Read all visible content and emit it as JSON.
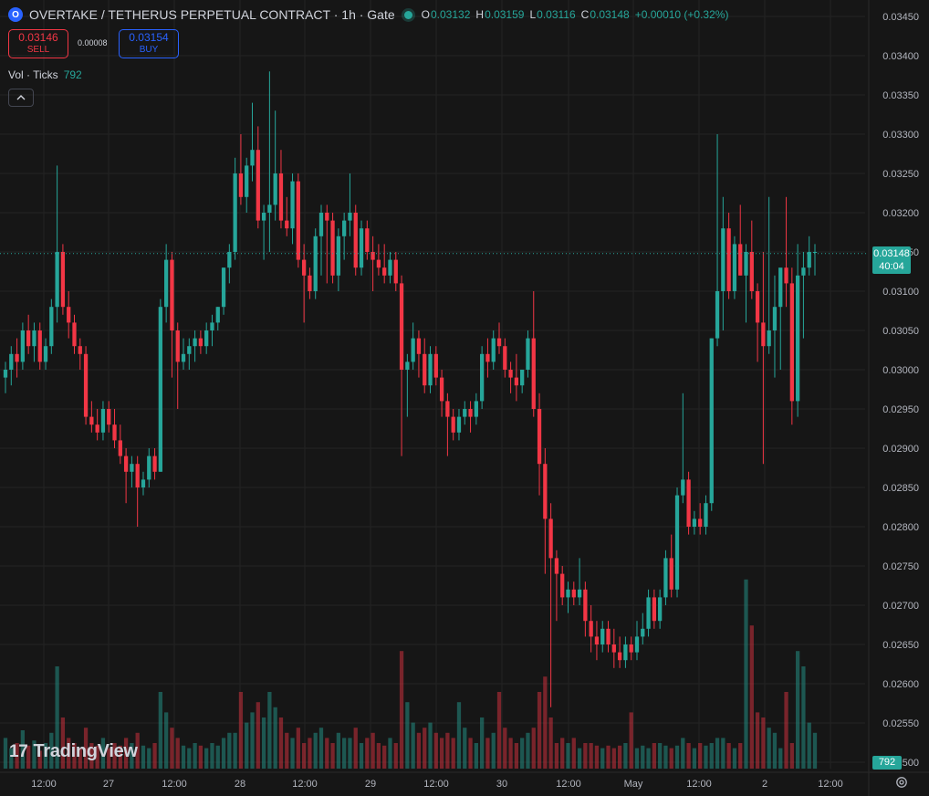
{
  "header": {
    "symbol_icon": "O",
    "title": "OVERTAKE / TETHERUS PERPETUAL CONTRACT · 1h · Gate",
    "o_label": "O",
    "o_value": "0.03132",
    "h_label": "H",
    "h_value": "0.03159",
    "l_label": "L",
    "l_value": "0.03116",
    "c_label": "C",
    "c_value": "0.03148",
    "change": "+0.00010 (+0.32%)"
  },
  "trade": {
    "sell_price": "0.03146",
    "sell_label": "SELL",
    "spread": "0.00008",
    "buy_price": "0.03154",
    "buy_label": "BUY"
  },
  "volume_legend": {
    "label": "Vol · Ticks",
    "value": "792"
  },
  "collapse_icon": "chevron-up-icon",
  "logo": {
    "mark": "17",
    "text": "TradingView"
  },
  "last_price_label": {
    "price": "0.03148",
    "countdown": "40:04"
  },
  "volume_label": "792",
  "settings_icon": "gear-icon",
  "colors": {
    "up": "#26a69a",
    "down": "#f23645",
    "background": "#161616",
    "grid": "#242424"
  },
  "chart_data": {
    "type": "candlestick",
    "title": "OVERTAKE / TETHERUS PERPETUAL CONTRACT · 1h · Gate",
    "ylim": [
      0.02485,
      0.03465
    ],
    "y_ticks": [
      "0.03450",
      "0.03400",
      "0.03350",
      "0.03300",
      "0.03250",
      "0.03200",
      "0.03150",
      "0.03100",
      "0.03050",
      "0.03000",
      "0.02950",
      "0.02900",
      "0.02850",
      "0.02800",
      "0.02750",
      "0.02700",
      "0.02650",
      "0.02600",
      "0.02550",
      "0.02500"
    ],
    "x_ticks": [
      "12:00",
      "27",
      "12:00",
      "28",
      "12:00",
      "29",
      "12:00",
      "30",
      "12:00",
      "May",
      "12:00",
      "2",
      "12:00"
    ],
    "last_price": 0.03148,
    "series": [
      {
        "name": "Price",
        "values": [
          [
            0.0299,
            0.0301,
            0.0297,
            0.03
          ],
          [
            0.03,
            0.0303,
            0.0298,
            0.0302
          ],
          [
            0.0302,
            0.0304,
            0.0299,
            0.0301
          ],
          [
            0.0301,
            0.0306,
            0.03,
            0.0305
          ],
          [
            0.0305,
            0.0307,
            0.0302,
            0.0303
          ],
          [
            0.0303,
            0.0306,
            0.0301,
            0.0305
          ],
          [
            0.0305,
            0.0306,
            0.03,
            0.0301
          ],
          [
            0.0301,
            0.0304,
            0.03,
            0.0303
          ],
          [
            0.0303,
            0.0309,
            0.0302,
            0.0308
          ],
          [
            0.0308,
            0.0326,
            0.0306,
            0.0315
          ],
          [
            0.0315,
            0.0316,
            0.0307,
            0.0308
          ],
          [
            0.0308,
            0.031,
            0.0304,
            0.0306
          ],
          [
            0.0306,
            0.0307,
            0.0302,
            0.0303
          ],
          [
            0.0303,
            0.0304,
            0.03,
            0.0302
          ],
          [
            0.0302,
            0.0303,
            0.0293,
            0.0294
          ],
          [
            0.0294,
            0.0296,
            0.0292,
            0.0293
          ],
          [
            0.0293,
            0.0295,
            0.0291,
            0.0292
          ],
          [
            0.0292,
            0.0296,
            0.0291,
            0.0295
          ],
          [
            0.0295,
            0.0296,
            0.0292,
            0.0293
          ],
          [
            0.0293,
            0.0295,
            0.029,
            0.0291
          ],
          [
            0.0291,
            0.0293,
            0.0288,
            0.0289
          ],
          [
            0.0289,
            0.029,
            0.0283,
            0.0287
          ],
          [
            0.0287,
            0.0289,
            0.0285,
            0.0288
          ],
          [
            0.0288,
            0.0289,
            0.028,
            0.0285
          ],
          [
            0.0285,
            0.0287,
            0.0284,
            0.0286
          ],
          [
            0.0286,
            0.029,
            0.0285,
            0.0289
          ],
          [
            0.0289,
            0.029,
            0.0286,
            0.0287
          ],
          [
            0.0287,
            0.0309,
            0.0287,
            0.0308
          ],
          [
            0.0308,
            0.0316,
            0.0306,
            0.0314
          ],
          [
            0.0314,
            0.0315,
            0.0299,
            0.0305
          ],
          [
            0.0305,
            0.0306,
            0.0295,
            0.0301
          ],
          [
            0.0301,
            0.0304,
            0.03,
            0.0302
          ],
          [
            0.0302,
            0.0304,
            0.03,
            0.0303
          ],
          [
            0.0303,
            0.0305,
            0.0301,
            0.0304
          ],
          [
            0.0304,
            0.0305,
            0.0302,
            0.0303
          ],
          [
            0.0303,
            0.0306,
            0.0302,
            0.0305
          ],
          [
            0.0305,
            0.0307,
            0.0303,
            0.0306
          ],
          [
            0.0306,
            0.0308,
            0.0305,
            0.0308
          ],
          [
            0.0308,
            0.0313,
            0.0307,
            0.0313
          ],
          [
            0.0313,
            0.0316,
            0.0311,
            0.0315
          ],
          [
            0.0315,
            0.0327,
            0.0314,
            0.0325
          ],
          [
            0.0325,
            0.033,
            0.0321,
            0.0322
          ],
          [
            0.0322,
            0.0327,
            0.032,
            0.0326
          ],
          [
            0.0326,
            0.0334,
            0.0324,
            0.0328
          ],
          [
            0.0328,
            0.0331,
            0.0318,
            0.0319
          ],
          [
            0.0319,
            0.0321,
            0.0314,
            0.032
          ],
          [
            0.032,
            0.0338,
            0.0315,
            0.0321
          ],
          [
            0.0321,
            0.0333,
            0.0319,
            0.0325
          ],
          [
            0.0325,
            0.0328,
            0.0318,
            0.0319
          ],
          [
            0.0319,
            0.0322,
            0.0317,
            0.0318
          ],
          [
            0.0318,
            0.0325,
            0.0316,
            0.0324
          ],
          [
            0.0324,
            0.0325,
            0.0313,
            0.0314
          ],
          [
            0.0314,
            0.0316,
            0.0306,
            0.0312
          ],
          [
            0.0312,
            0.0313,
            0.0309,
            0.031
          ],
          [
            0.031,
            0.0318,
            0.0309,
            0.0317
          ],
          [
            0.0317,
            0.0321,
            0.0312,
            0.032
          ],
          [
            0.032,
            0.0321,
            0.0311,
            0.0319
          ],
          [
            0.0319,
            0.032,
            0.0311,
            0.0312
          ],
          [
            0.0312,
            0.0318,
            0.031,
            0.0317
          ],
          [
            0.0317,
            0.032,
            0.0314,
            0.0319
          ],
          [
            0.0319,
            0.0325,
            0.0317,
            0.032
          ],
          [
            0.032,
            0.0321,
            0.0312,
            0.0313
          ],
          [
            0.0313,
            0.0319,
            0.0312,
            0.0318
          ],
          [
            0.0318,
            0.0319,
            0.0314,
            0.0315
          ],
          [
            0.0315,
            0.0317,
            0.031,
            0.0314
          ],
          [
            0.0314,
            0.0316,
            0.0312,
            0.0313
          ],
          [
            0.0313,
            0.0316,
            0.0311,
            0.0312
          ],
          [
            0.0312,
            0.0315,
            0.0311,
            0.0314
          ],
          [
            0.0314,
            0.0315,
            0.031,
            0.0311
          ],
          [
            0.0311,
            0.0312,
            0.0289,
            0.03
          ],
          [
            0.03,
            0.0302,
            0.0294,
            0.0301
          ],
          [
            0.0301,
            0.0306,
            0.03,
            0.0304
          ],
          [
            0.0304,
            0.0305,
            0.0299,
            0.0302
          ],
          [
            0.0302,
            0.0304,
            0.0297,
            0.0298
          ],
          [
            0.0298,
            0.0303,
            0.0297,
            0.0302
          ],
          [
            0.0302,
            0.0303,
            0.0298,
            0.0299
          ],
          [
            0.0299,
            0.03,
            0.0294,
            0.0296
          ],
          [
            0.0296,
            0.0297,
            0.0289,
            0.0294
          ],
          [
            0.0294,
            0.0295,
            0.0291,
            0.0292
          ],
          [
            0.0292,
            0.0295,
            0.0291,
            0.0294
          ],
          [
            0.0294,
            0.0296,
            0.0293,
            0.0295
          ],
          [
            0.0295,
            0.0296,
            0.0292,
            0.0294
          ],
          [
            0.0294,
            0.0297,
            0.0293,
            0.0296
          ],
          [
            0.0296,
            0.0303,
            0.0295,
            0.0302
          ],
          [
            0.0302,
            0.0304,
            0.0299,
            0.0301
          ],
          [
            0.0301,
            0.0305,
            0.03,
            0.0304
          ],
          [
            0.0304,
            0.0306,
            0.0302,
            0.0303
          ],
          [
            0.0303,
            0.0304,
            0.0299,
            0.03
          ],
          [
            0.03,
            0.0301,
            0.0297,
            0.0299
          ],
          [
            0.0299,
            0.0302,
            0.0296,
            0.0298
          ],
          [
            0.0298,
            0.03,
            0.0297,
            0.03
          ],
          [
            0.03,
            0.0305,
            0.0299,
            0.0304
          ],
          [
            0.0304,
            0.031,
            0.0294,
            0.0295
          ],
          [
            0.0295,
            0.0297,
            0.0284,
            0.0288
          ],
          [
            0.0288,
            0.029,
            0.0274,
            0.0281
          ],
          [
            0.0281,
            0.0283,
            0.0257,
            0.0276
          ],
          [
            0.0276,
            0.0277,
            0.0268,
            0.0274
          ],
          [
            0.0274,
            0.0275,
            0.027,
            0.0271
          ],
          [
            0.0271,
            0.0273,
            0.0269,
            0.0272
          ],
          [
            0.0272,
            0.0273,
            0.027,
            0.0271
          ],
          [
            0.0271,
            0.0276,
            0.027,
            0.0272
          ],
          [
            0.0272,
            0.0273,
            0.0266,
            0.0268
          ],
          [
            0.0268,
            0.027,
            0.0264,
            0.0266
          ],
          [
            0.0266,
            0.0268,
            0.0263,
            0.0265
          ],
          [
            0.0265,
            0.0268,
            0.0264,
            0.0267
          ],
          [
            0.0267,
            0.0268,
            0.0264,
            0.0265
          ],
          [
            0.0265,
            0.0267,
            0.0262,
            0.0264
          ],
          [
            0.0264,
            0.0266,
            0.0262,
            0.0263
          ],
          [
            0.0263,
            0.0266,
            0.0262,
            0.0265
          ],
          [
            0.0265,
            0.0266,
            0.0263,
            0.0264
          ],
          [
            0.0264,
            0.0268,
            0.0263,
            0.0266
          ],
          [
            0.0266,
            0.0269,
            0.0265,
            0.0267
          ],
          [
            0.0267,
            0.0272,
            0.0266,
            0.0271
          ],
          [
            0.0271,
            0.0272,
            0.0267,
            0.0268
          ],
          [
            0.0268,
            0.0272,
            0.0267,
            0.0271
          ],
          [
            0.0271,
            0.0277,
            0.027,
            0.0276
          ],
          [
            0.0276,
            0.0279,
            0.0271,
            0.0272
          ],
          [
            0.0272,
            0.0285,
            0.0271,
            0.0284
          ],
          [
            0.0284,
            0.0297,
            0.0283,
            0.0286
          ],
          [
            0.0286,
            0.0287,
            0.0279,
            0.028
          ],
          [
            0.028,
            0.0282,
            0.0279,
            0.0281
          ],
          [
            0.0281,
            0.0283,
            0.0279,
            0.028
          ],
          [
            0.028,
            0.0284,
            0.0279,
            0.0283
          ],
          [
            0.0283,
            0.0304,
            0.0282,
            0.0304
          ],
          [
            0.0304,
            0.033,
            0.0303,
            0.031
          ],
          [
            0.031,
            0.0322,
            0.0305,
            0.0318
          ],
          [
            0.0318,
            0.032,
            0.0309,
            0.031
          ],
          [
            0.031,
            0.0317,
            0.0309,
            0.0316
          ],
          [
            0.0316,
            0.0321,
            0.0312,
            0.0312
          ],
          [
            0.0312,
            0.0316,
            0.0306,
            0.0315
          ],
          [
            0.0315,
            0.0319,
            0.0309,
            0.031
          ],
          [
            0.031,
            0.0311,
            0.0301,
            0.0306
          ],
          [
            0.0306,
            0.0315,
            0.0288,
            0.0303
          ],
          [
            0.0303,
            0.0322,
            0.0302,
            0.0305
          ],
          [
            0.0305,
            0.0312,
            0.0299,
            0.0308
          ],
          [
            0.0308,
            0.0311,
            0.03,
            0.0313
          ],
          [
            0.0313,
            0.0322,
            0.0308,
            0.0311
          ],
          [
            0.0311,
            0.0313,
            0.0293,
            0.0296
          ],
          [
            0.0296,
            0.0316,
            0.0294,
            0.0312
          ],
          [
            0.0312,
            0.0315,
            0.0304,
            0.0313
          ],
          [
            0.0313,
            0.0317,
            0.0312,
            0.0315
          ],
          [
            0.0315,
            0.0316,
            0.0312,
            0.0315
          ]
        ]
      },
      {
        "name": "Vol · Ticks",
        "values": [
          12,
          8,
          10,
          15,
          9,
          11,
          7,
          10,
          14,
          40,
          20,
          12,
          10,
          8,
          16,
          10,
          9,
          12,
          8,
          10,
          9,
          12,
          10,
          14,
          9,
          8,
          10,
          30,
          22,
          16,
          12,
          9,
          8,
          10,
          9,
          8,
          10,
          9,
          12,
          14,
          14,
          30,
          18,
          22,
          26,
          20,
          30,
          24,
          20,
          14,
          12,
          16,
          10,
          12,
          14,
          16,
          12,
          10,
          14,
          12,
          12,
          16,
          10,
          12,
          14,
          10,
          9,
          12,
          10,
          46,
          26,
          18,
          14,
          16,
          18,
          14,
          12,
          14,
          12,
          26,
          16,
          12,
          10,
          20,
          12,
          14,
          30,
          16,
          12,
          10,
          12,
          14,
          16,
          30,
          36,
          20,
          10,
          12,
          10,
          12,
          8,
          10,
          10,
          9,
          8,
          9,
          8,
          9,
          10,
          22,
          8,
          9,
          8,
          10,
          10,
          9,
          8,
          9,
          12,
          10,
          8,
          10,
          9,
          10,
          12,
          12,
          10,
          8,
          10,
          74,
          56,
          22,
          20,
          16,
          14,
          8,
          30,
          10,
          46,
          40,
          18,
          14,
          8,
          10
        ]
      }
    ]
  }
}
